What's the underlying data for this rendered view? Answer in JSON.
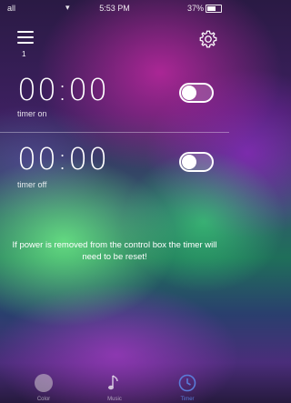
{
  "status_bar": {
    "carrier": "all",
    "time": "5:53 PM",
    "battery": "37%"
  },
  "header": {
    "menu_icon": "hamburger-menu-icon",
    "menu_badge": "1",
    "settings_icon": "gear-icon"
  },
  "timers": [
    {
      "time": "00:00",
      "label": "timer on",
      "enabled": false
    },
    {
      "time": "00:00",
      "label": "timer off",
      "enabled": false
    }
  ],
  "notice": "If power is removed from the control box the timer will need to be reset!",
  "tabs": [
    {
      "label": "Color",
      "icon": "color-dot-icon",
      "active": false
    },
    {
      "label": "Music",
      "icon": "music-note-icon",
      "active": false
    },
    {
      "label": "Timer",
      "icon": "timer-clock-icon",
      "active": true
    }
  ]
}
